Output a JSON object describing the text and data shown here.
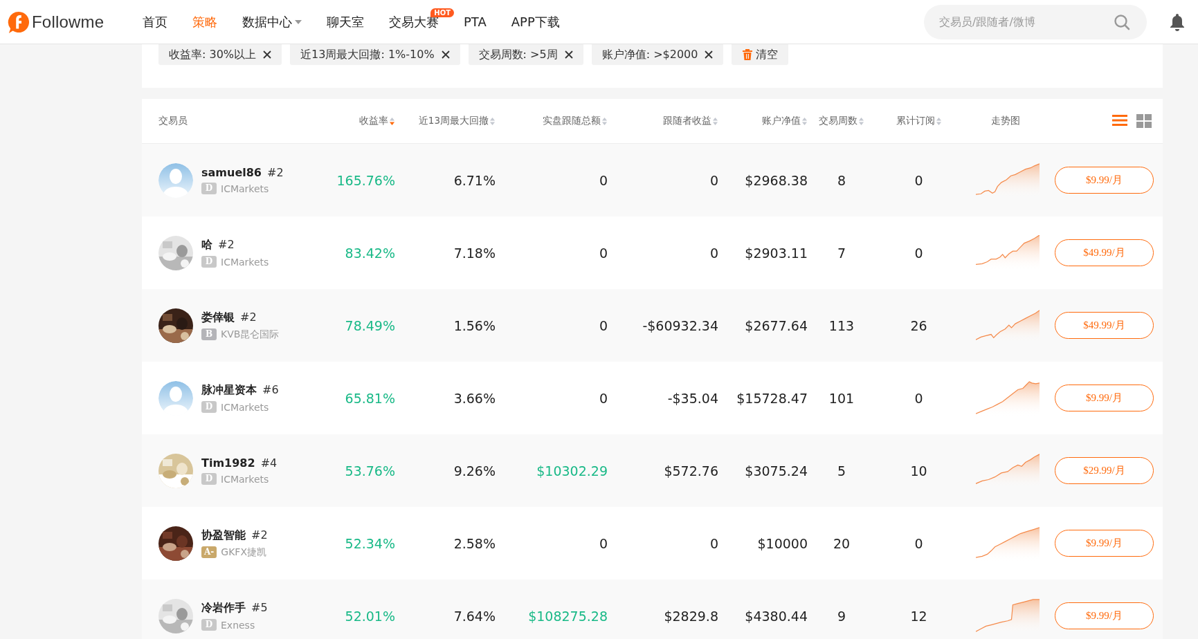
{
  "nav": {
    "logo_text": "Followme",
    "items": [
      {
        "label": "首页",
        "selected": false
      },
      {
        "label": "策略",
        "selected": true
      },
      {
        "label": "数据中心",
        "selected": false,
        "dropdown": true
      },
      {
        "label": "聊天室",
        "selected": false
      },
      {
        "label": "交易大赛",
        "selected": false,
        "badge": "HOT"
      },
      {
        "label": "PTA",
        "selected": false
      },
      {
        "label": "APP下载",
        "selected": false
      }
    ],
    "search": {
      "placeholder": "交易员/跟随者/微博"
    }
  },
  "filters": {
    "chips": [
      {
        "label": "收益率:  30%以上"
      },
      {
        "label": "近13周最大回撤:  1%-10%"
      },
      {
        "label": "交易周数:  >5周"
      },
      {
        "label": "账户净值:  >$2000"
      }
    ],
    "clear": "清空"
  },
  "table": {
    "columns": [
      {
        "label": "交易员",
        "kind": "plain"
      },
      {
        "label": "收益率",
        "kind": "sortable",
        "sort_active": true
      },
      {
        "label": "近13周最大回撤",
        "kind": "sortable",
        "sort_active": false
      },
      {
        "label": "实盘跟随总额",
        "kind": "sortable",
        "sort_active": false
      },
      {
        "label": "跟随者收益",
        "kind": "sortable",
        "sort_active": false
      },
      {
        "label": "账户净值",
        "kind": "sortable",
        "sort_active": false
      },
      {
        "label": "交易周数",
        "kind": "sortable",
        "sort_active": false
      },
      {
        "label": "累计订阅",
        "kind": "sortable",
        "sort_active": false
      },
      {
        "label": "走势图",
        "kind": "plain"
      }
    ],
    "view_modes": [
      {
        "kind": "list",
        "selected": true
      },
      {
        "kind": "grid",
        "selected": false
      }
    ],
    "rows": [
      {
        "name": "**samuel86** #2",
        "avatar": {
          "kind": "default"
        },
        "grade": {
          "text": "D",
          "color": "#c8c8c8"
        },
        "broker": "ICMarkets",
        "return": "165.76%",
        "drawdown": "6.71%",
        "follow_total": {
          "text": "0",
          "positive": false
        },
        "follower_profit": "0",
        "equity": "$2968.38",
        "weeks": "8",
        "subscriptions": "0",
        "price": "$9.99/月"
      },
      {
        "name": "**哈** #2",
        "grade": {
          "text": "D",
          "color": "#c8c8c8"
        },
        "broker": "ICMarkets",
        "return": "83.42%",
        "drawdown": "7.18%",
        "follow_total": {
          "text": "0",
          "positive": false
        },
        "follower_profit": "0",
        "equity": "$2903.11",
        "weeks": "7",
        "subscriptions": "0",
        "price": "$49.99/月"
      },
      {
        "name": "**娄倖银** #2",
        "grade": {
          "text": "B",
          "color": "#b4b4b8"
        },
        "broker": "KVB昆仑国际",
        "return": "78.49%",
        "drawdown": "1.56%",
        "follow_total": {
          "text": "0",
          "positive": false
        },
        "follower_profit": "-$60932.34",
        "equity": "$2677.64",
        "weeks": "113",
        "subscriptions": "26",
        "price": "$49.99/月"
      },
      {
        "name": "**脉冲星资本** #6",
        "avatar": {
          "kind": "default"
        },
        "grade": {
          "text": "D",
          "color": "#c8c8c8"
        },
        "broker": "ICMarkets",
        "return": "65.81%",
        "drawdown": "3.66%",
        "follow_total": {
          "text": "0",
          "positive": false
        },
        "follower_profit": "-$35.04",
        "equity": "$15728.47",
        "weeks": "101",
        "subscriptions": "0",
        "price": "$9.99/月"
      },
      {
        "name": "**Tim1982** #4",
        "grade": {
          "text": "D",
          "color": "#c8c8c8"
        },
        "broker": "ICMarkets",
        "return": "53.76%",
        "drawdown": "9.26%",
        "follow_total": {
          "text": "$10302.29",
          "positive": true
        },
        "follower_profit": "$572.76",
        "equity": "$3075.24",
        "weeks": "5",
        "subscriptions": "10",
        "price": "$29.99/月"
      },
      {
        "name": "**协盈智能** #2",
        "grade": {
          "text": "A-",
          "color": "#c9a86a"
        },
        "broker": "GKFX捷凯",
        "return": "52.34%",
        "drawdown": "2.58%",
        "follow_total": {
          "text": "0",
          "positive": false
        },
        "follower_profit": "0",
        "equity": "$10000",
        "weeks": "20",
        "subscriptions": "0",
        "price": "$9.99/月"
      },
      {
        "name": "**冷岩作手** #5",
        "grade": {
          "text": "D",
          "color": "#c8c8c8"
        },
        "broker": "Exness",
        "return": "52.01%",
        "drawdown": "7.64%",
        "follow_total": {
          "text": "$108275.28",
          "positive": true
        },
        "follower_profit": "$2829.8",
        "equity": "$4380.44",
        "weeks": "9",
        "subscriptions": "12",
        "price": "$9.99/月"
      }
    ]
  }
}
